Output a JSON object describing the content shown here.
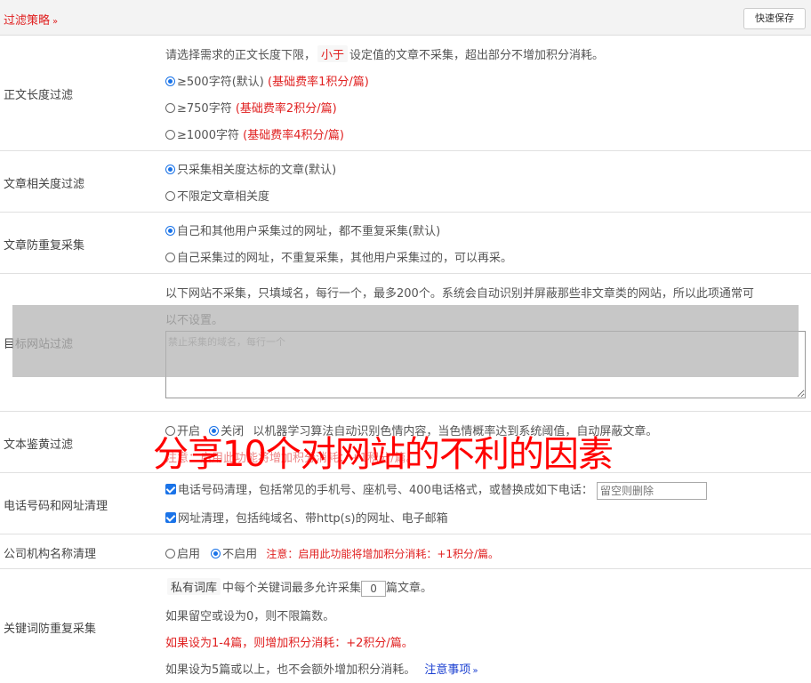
{
  "header": {
    "title": "过滤策略",
    "chevron": "»",
    "save_label": "快速保存"
  },
  "length_filter": {
    "label": "正文长度过滤",
    "desc_prefix": "请选择需求的正文长度下限，",
    "desc_tag": "小于",
    "desc_suffix": "设定值的文章不采集，超出部分不增加积分消耗。",
    "options": [
      {
        "text": "≥500字符(默认)",
        "note": "(基础费率1积分/篇)",
        "selected": true
      },
      {
        "text": "≥750字符",
        "note": "(基础费率2积分/篇)",
        "selected": false
      },
      {
        "text": "≥1000字符",
        "note": "(基础费率4积分/篇)",
        "selected": false
      }
    ]
  },
  "relevance": {
    "label": "文章相关度过滤",
    "options": [
      {
        "text": "只采集相关度达标的文章(默认)",
        "selected": true
      },
      {
        "text": "不限定文章相关度",
        "selected": false
      }
    ]
  },
  "dedupe": {
    "label": "文章防重复采集",
    "options": [
      {
        "text": "自己和其他用户采集过的网址，都不重复采集(默认)",
        "selected": true
      },
      {
        "text": "自己采集过的网址，不重复采集，其他用户采集过的，可以再采。",
        "selected": false
      }
    ]
  },
  "site_filter": {
    "label": "目标网站过滤",
    "desc_line1": "以下网站不采集，只填域名，每行一个，最多200个。系统会自动识别并屏蔽那些非文章类的网站，所以此项通常可",
    "desc_line2": "以不设置。",
    "placeholder": "禁止采集的域名，每行一个"
  },
  "porn_filter": {
    "label": "文本鉴黄过滤",
    "on_label": "开启",
    "off_label": "关闭",
    "desc": "以机器学习算法自动识别色情内容，当色情概率达到系统阈值，自动屏蔽文章。",
    "note": "注意：启用此功能将增加积分消耗：+1积分/篇。"
  },
  "phone_filter": {
    "label": "电话号码和网址清理",
    "phone_text": "电话号码清理，包括常见的手机号、座机号、400电话格式，或替换成如下电话：",
    "phone_placeholder": "留空则删除",
    "url_text": "网址清理，包括纯域名、带http(s)的网址、电子邮箱"
  },
  "org_filter": {
    "label": "公司机构名称清理",
    "enable_label": "启用",
    "disable_label": "不启用",
    "note": "注意：启用此功能将增加积分消耗：+1积分/篇。"
  },
  "keyword_dedupe": {
    "label": "关键词防重复采集",
    "tag": "私有词库",
    "text_before": "中每个关键词最多允许采集",
    "value": "0",
    "text_after": "篇文章。",
    "line2": "如果留空或设为0，则不限篇数。",
    "line3": "如果设为1-4篇，则增加积分消耗：+2积分/篇。",
    "line4": "如果设为5篇或以上，也不会额外增加积分消耗。",
    "link": "注意事项",
    "link_chevron": "»"
  },
  "overlay_title": "分享10个对网站的不利的因素"
}
